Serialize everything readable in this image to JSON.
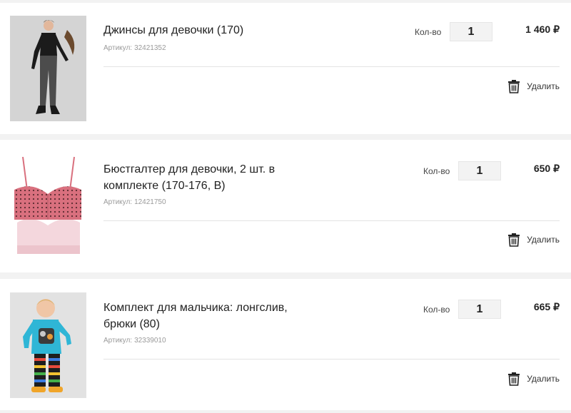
{
  "items": [
    {
      "title": "Джинсы для девочки (170)",
      "sku_label": "Артикул:",
      "sku": "32421352",
      "qty_label": "Кол-во",
      "qty": "1",
      "price": "1 460 ₽",
      "delete_label": "Удалить",
      "image": "girl-jeans-photo"
    },
    {
      "title": "Бюстгалтер для девочки, 2 шт. в комплекте (170-176, B)",
      "sku_label": "Артикул:",
      "sku": "12421750",
      "qty_label": "Кол-во",
      "qty": "1",
      "price": "650 ₽",
      "delete_label": "Удалить",
      "image": "bra-set-photo"
    },
    {
      "title": "Комплект для мальчика: лонгслив, брюки (80)",
      "sku_label": "Артикул:",
      "sku": "32339010",
      "qty_label": "Кол-во",
      "qty": "1",
      "price": "665 ₽",
      "delete_label": "Удалить",
      "image": "boy-set-photo"
    }
  ],
  "icons": {
    "delete": "trash-icon"
  }
}
